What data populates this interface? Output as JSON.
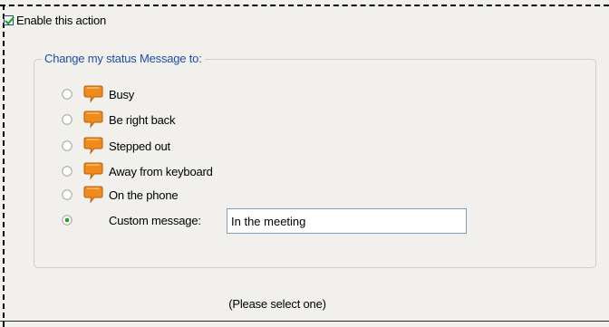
{
  "enable_action": {
    "label": "Enable this action",
    "checked": true
  },
  "status_group": {
    "title": "Change my status Message to:",
    "options": [
      {
        "label": "Busy",
        "icon": "speech-bubble-icon",
        "selected": false
      },
      {
        "label": "Be right back",
        "icon": "speech-bubble-icon",
        "selected": false
      },
      {
        "label": "Stepped out",
        "icon": "speech-bubble-icon",
        "selected": false
      },
      {
        "label": "Away from keyboard",
        "icon": "speech-bubble-icon",
        "selected": false
      },
      {
        "label": "On the phone",
        "icon": "speech-bubble-icon",
        "selected": false
      }
    ],
    "custom": {
      "label": "Custom message:",
      "value": "In the meeting",
      "selected": true
    }
  },
  "hint": "(Please select one)",
  "colors": {
    "panel_background": "#f1f0ec",
    "group_title": "#1f4ea8",
    "checkmark": "#21a121",
    "radio_selected_dot": "#21a121",
    "status_icon": "#f08a1c",
    "input_border": "#7f9db9"
  }
}
